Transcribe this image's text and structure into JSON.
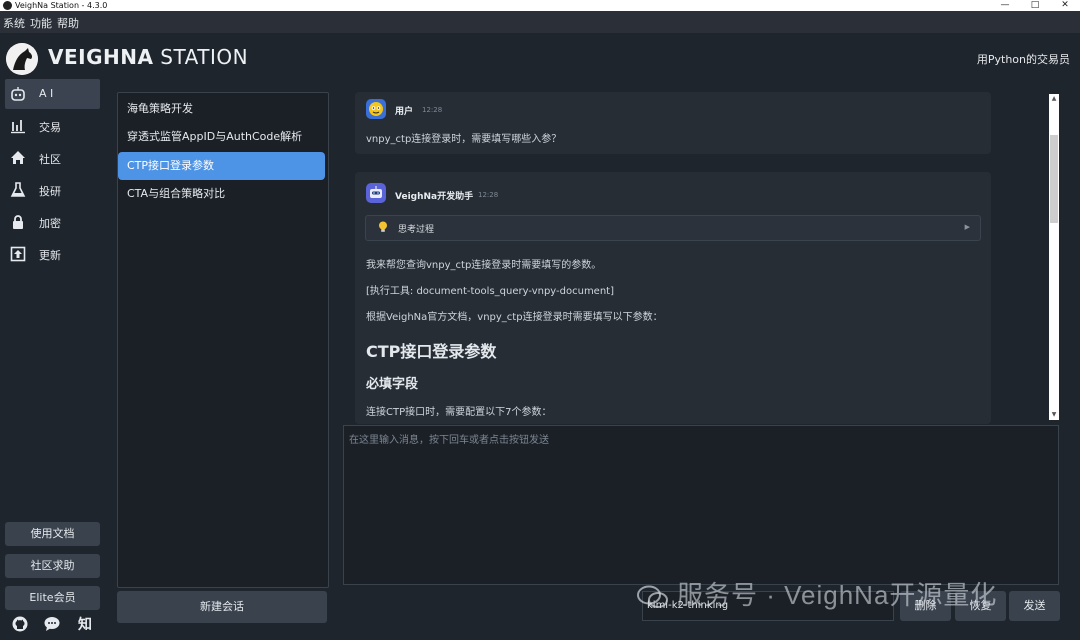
{
  "window": {
    "title": "VeighNa Station - 4.3.0"
  },
  "menu": [
    "系统",
    "功能",
    "帮助"
  ],
  "header": {
    "brand_bold": "VEIGHNA",
    "brand_light": " STATION",
    "slogan": "用Python的交易员"
  },
  "sidebar": {
    "items": [
      {
        "label": "A I",
        "icon": "robot-icon",
        "active": true
      },
      {
        "label": "交易",
        "icon": "trade-chart-icon",
        "active": false
      },
      {
        "label": "社区",
        "icon": "home-icon",
        "active": false
      },
      {
        "label": "投研",
        "icon": "flask-icon",
        "active": false
      },
      {
        "label": "加密",
        "icon": "lock-icon",
        "active": false
      },
      {
        "label": "更新",
        "icon": "upload-icon",
        "active": false
      }
    ],
    "buttons": [
      "使用文档",
      "社区求助",
      "Elite会员"
    ],
    "footer_icons": [
      "github-icon",
      "chat-bubble-icon"
    ],
    "footer_zhihu": "知"
  },
  "sessions": {
    "items": [
      "海龟策略开发",
      "穿透式监管AppID与AuthCode解析",
      "CTP接口登录参数",
      "CTA与组合策略对比"
    ],
    "active_index": 2,
    "new_label": "新建会话"
  },
  "chat": {
    "user": {
      "name": "用户",
      "time": "12:28",
      "text": "vnpy_ctp连接登录时，需要填写哪些入参？"
    },
    "assistant": {
      "name": "VeighNa开发助手",
      "time": "12:28",
      "thinking_label": "思考过程",
      "lines": [
        "我来帮您查询vnpy_ctp连接登录时需要填写的参数。",
        "[执行工具: document-tools_query-vnpy-document]",
        "根据VeighNa官方文档，vnpy_ctp连接登录时需要填写以下参数："
      ],
      "heading": "CTP接口登录参数",
      "subheading": "必填字段",
      "last_line": "连接CTP接口时，需要配置以下7个参数："
    }
  },
  "input": {
    "placeholder": "在这里输入消息，按下回车或者点击按钮发送"
  },
  "controls": {
    "model": "kimi-k2-thinking",
    "buttons": [
      "删除",
      "恢复",
      "发送"
    ]
  },
  "watermark": "服务号 · VeighNa开源量化",
  "colors": {
    "accent": "#4d93e6",
    "background": "#1f252d",
    "panel": "#262d35"
  }
}
